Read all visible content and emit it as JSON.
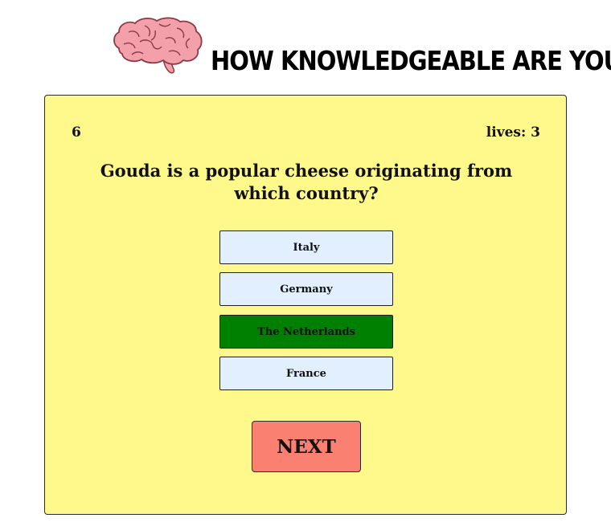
{
  "header": {
    "title": "HOW KNOWLEDGEABLE ARE YOU?",
    "logo_icon": "brain-icon"
  },
  "quiz": {
    "score": "6",
    "lives": "lives: 3",
    "question": "Gouda is a popular cheese originating from which country?",
    "answers": [
      {
        "label": "Italy",
        "state": "default"
      },
      {
        "label": "Germany",
        "state": "default"
      },
      {
        "label": "The Netherlands",
        "state": "correct"
      },
      {
        "label": "France",
        "state": "default"
      }
    ],
    "next_label": "NEXT"
  },
  "colors": {
    "card_background": "#fff98c",
    "answer_background": "#e1efff",
    "correct_answer": "#008000",
    "next_button": "#fa8072",
    "brain": "#f4a0aa"
  }
}
